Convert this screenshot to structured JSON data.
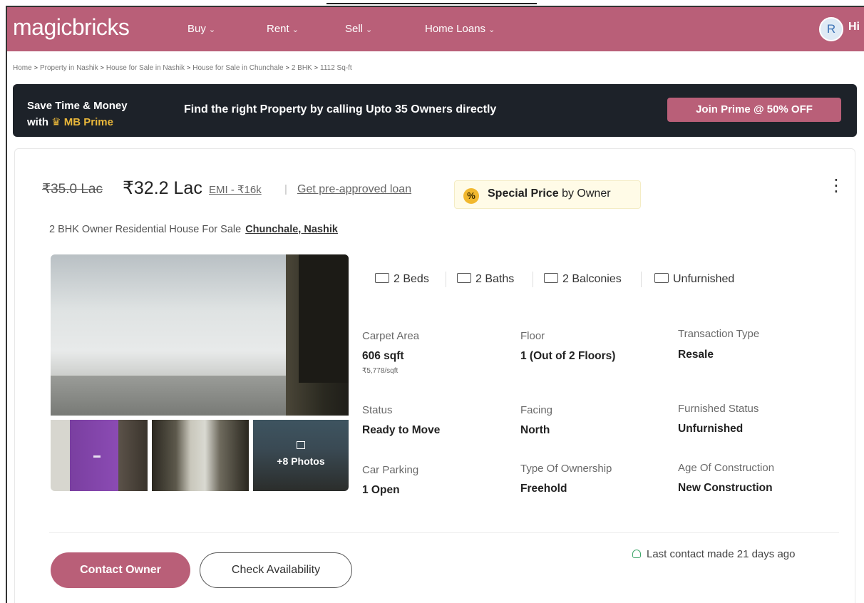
{
  "header": {
    "logo": "magicbricks",
    "nav": [
      "Buy",
      "Rent",
      "Sell",
      "Home Loans"
    ],
    "avatar_initial": "R",
    "greeting": "Hi"
  },
  "breadcrumb": [
    "Home",
    "Property in Nashik",
    "House for Sale in Nashik",
    "House for Sale in Chunchale",
    "2 BHK",
    "1112 Sq-ft"
  ],
  "prime_banner": {
    "line1": "Save Time & Money",
    "line2_prefix": "with",
    "brand": "MB Prime",
    "message": "Find the right Property by calling Upto 35 Owners directly",
    "cta": "Join Prime @ 50% OFF"
  },
  "listing": {
    "old_price": "₹35.0 Lac",
    "price": "₹32.2 Lac",
    "emi": "EMI - ₹16k",
    "separator": "|",
    "loan_link": "Get pre-approved loan",
    "special_badge": "%",
    "special_bold": "Special Price",
    "special_rest": "by Owner",
    "menu": "⋮",
    "title": "2 BHK Owner Residential House For Sale",
    "location": "Chunchale, Nashik",
    "photos_more": "+8 Photos",
    "amenities": [
      {
        "icon": "bed-icon",
        "label": "2 Beds"
      },
      {
        "icon": "bath-icon",
        "label": "2 Baths"
      },
      {
        "icon": "balcony-icon",
        "label": "2 Balconies"
      },
      {
        "icon": "furnish-icon",
        "label": "Unfurnished"
      }
    ],
    "summary": [
      {
        "label": "Carpet Area",
        "value": "606 sqft",
        "extra": "₹5,778/sqft"
      },
      {
        "label": "Floor",
        "value": "1 (Out of 2 Floors)"
      },
      {
        "label": "Transaction Type",
        "value": "Resale"
      },
      {
        "label": "Status",
        "value": "Ready to Move"
      },
      {
        "label": "Facing",
        "value": "North"
      },
      {
        "label": "Furnished Status",
        "value": "Unfurnished"
      },
      {
        "label": "Car Parking",
        "value": "1 Open"
      },
      {
        "label": "Type Of Ownership",
        "value": "Freehold"
      },
      {
        "label": "Age Of Construction",
        "value": "New Construction"
      }
    ],
    "contact_button": "Contact Owner",
    "check_button": "Check Availability",
    "last_contact": "Last contact made 21 days ago"
  }
}
